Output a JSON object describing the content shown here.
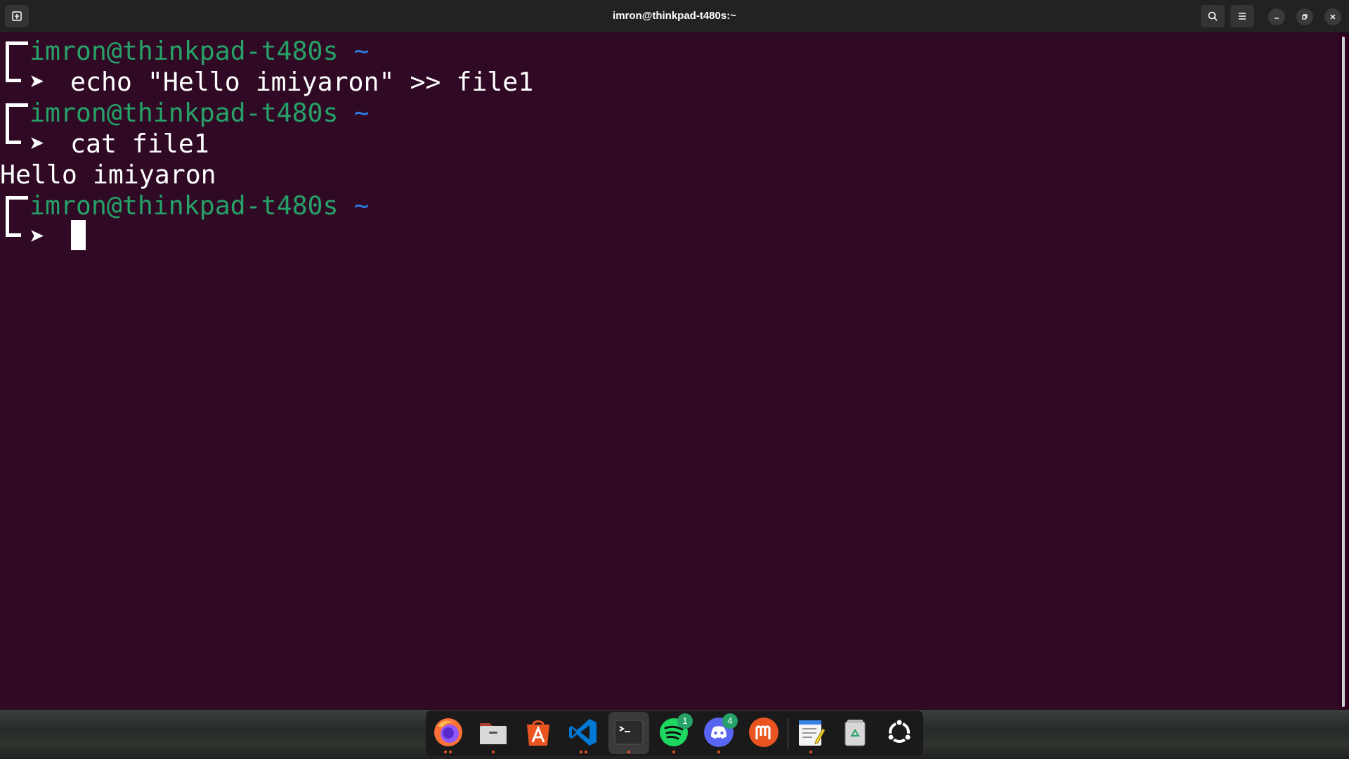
{
  "window": {
    "title": "imron@thinkpad-t480s:~"
  },
  "terminal": {
    "prompt_user": "imron@thinkpad-t480s",
    "prompt_path": "~",
    "lines": [
      {
        "type": "prompt"
      },
      {
        "type": "command",
        "text": "echo \"Hello imiyaron\" >> file1"
      },
      {
        "type": "prompt"
      },
      {
        "type": "command",
        "text": "cat file1"
      },
      {
        "type": "output",
        "text": "Hello imiyaron"
      },
      {
        "type": "prompt"
      },
      {
        "type": "command",
        "text": ""
      }
    ]
  },
  "dock": {
    "apps": [
      {
        "name": "Firefox",
        "icon": "firefox-icon",
        "running": true,
        "windows": 2
      },
      {
        "name": "Files",
        "icon": "files-icon",
        "running": true,
        "windows": 1
      },
      {
        "name": "Ubuntu Software",
        "icon": "app-store-icon",
        "running": false
      },
      {
        "name": "Visual Studio Code",
        "icon": "vscode-icon",
        "running": true,
        "windows": 2
      },
      {
        "name": "Terminal",
        "icon": "terminal-icon",
        "running": true,
        "windows": 1,
        "active": true
      },
      {
        "name": "Spotify",
        "icon": "spotify-icon",
        "running": true,
        "windows": 1,
        "badge": "1"
      },
      {
        "name": "Discord",
        "icon": "discord-icon",
        "running": true,
        "windows": 1,
        "badge": "4"
      },
      {
        "name": "Mastodon",
        "icon": "mastodon-icon",
        "running": false
      },
      {
        "name": "Text Editor",
        "icon": "text-editor-icon",
        "running": true,
        "windows": 1
      },
      {
        "name": "Trash",
        "icon": "trash-icon",
        "running": false
      },
      {
        "name": "Show Apps",
        "icon": "ubuntu-apps-icon",
        "running": false
      }
    ],
    "colors": {
      "running_dot": "#e95420",
      "badge": "#26a269"
    }
  },
  "colors": {
    "terminal_bg": "#300a24",
    "prompt_user": "#26a269",
    "prompt_path": "#2a7bde",
    "headerbar": "#222222"
  }
}
